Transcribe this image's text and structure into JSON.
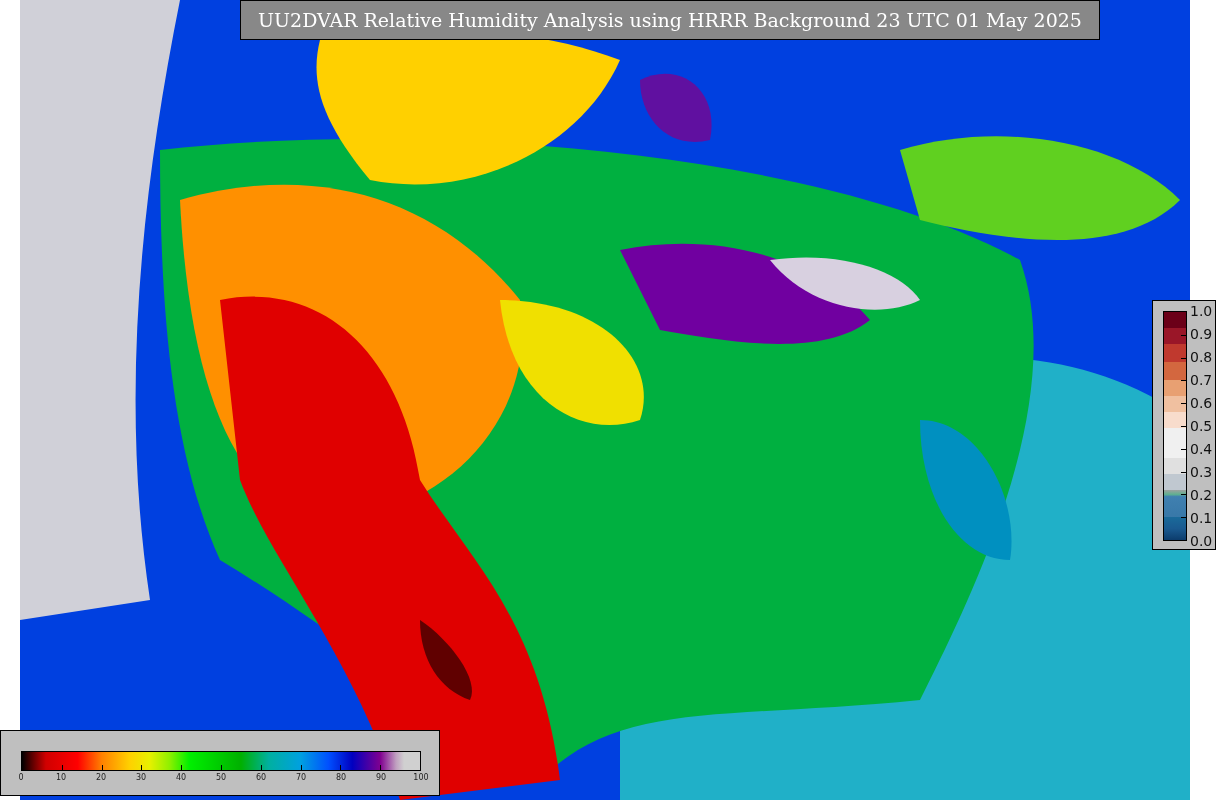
{
  "title": "UU2DVAR Relative Humidity Analysis using HRRR Background 23 UTC 01 May 2025",
  "difference_scale": {
    "labels": [
      "1.0",
      "0.9",
      "0.8",
      "0.7",
      "0.6",
      "0.5",
      "0.4",
      "0.3",
      "0.2",
      "0.1",
      "0.0"
    ]
  },
  "humidity_scale": {
    "labels": [
      "0",
      "10",
      "20",
      "30",
      "40",
      "50",
      "60",
      "70",
      "80",
      "90",
      "100"
    ]
  }
}
